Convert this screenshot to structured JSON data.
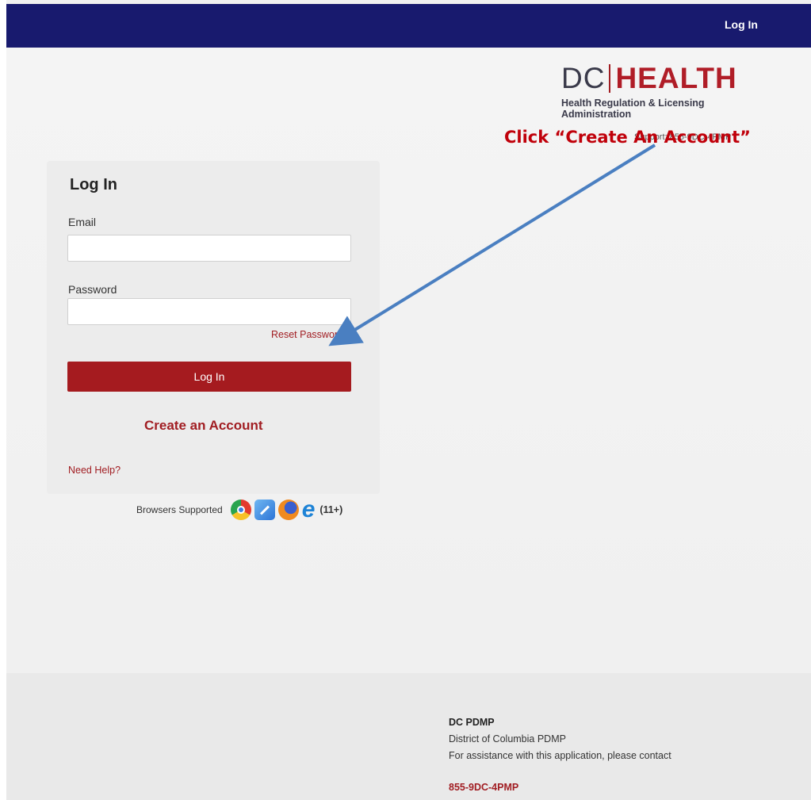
{
  "header": {
    "login_link": "Log In"
  },
  "logo": {
    "dc": "DC",
    "health": "HEALTH",
    "subtitle_line1": "Health Regulation & Licensing",
    "subtitle_line2": "Administration"
  },
  "support_text": "Support: 855-9DC-4PMP",
  "annotation_text": "Click “Create An Account”",
  "login": {
    "title": "Log In",
    "email_label": "Email",
    "email_value": "",
    "password_label": "Password",
    "password_value": "",
    "reset_password": "Reset Password",
    "login_button": "Log In",
    "create_account": "Create an Account",
    "need_help": "Need Help?"
  },
  "browsers": {
    "label": "Browsers Supported",
    "icons": [
      "chrome-icon",
      "safari-icon",
      "firefox-icon",
      "internet-explorer-icon"
    ],
    "ie_version": "(11+)"
  },
  "footer": {
    "title": "DC PDMP",
    "line1": "District of Columbia PDMP",
    "line2": "For assistance with this application, please contact",
    "phone": "855-9DC-4PMP"
  },
  "colors": {
    "topbar": "#181a6e",
    "accent_red": "#a51b1f",
    "annotation_red": "#c0000a",
    "arrow_blue": "#4a7fc1"
  }
}
